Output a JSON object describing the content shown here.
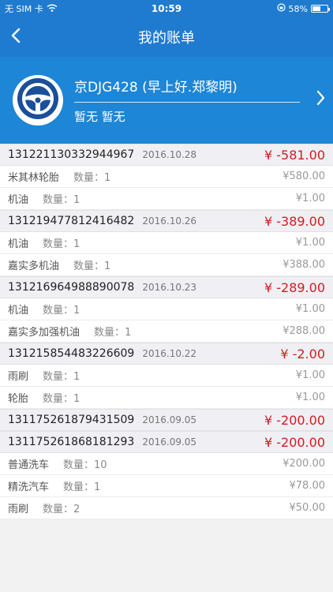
{
  "status": {
    "carrier": "无 SIM 卡",
    "time": "10:59",
    "battery": "58%",
    "battery_level": 0.58
  },
  "nav": {
    "title": "我的账单"
  },
  "profile": {
    "name": "京DJG428 (早上好.郑黎明)",
    "sub": "暂无 暂无"
  },
  "orders": [
    {
      "id": "131221130332944967",
      "date": "2016.10.28",
      "amount": "¥ -581.00",
      "items": [
        {
          "name": "米其林轮胎",
          "qty": "数量：1",
          "price": "¥580.00"
        },
        {
          "name": "机油",
          "qty": "数量：1",
          "price": "¥1.00"
        }
      ]
    },
    {
      "id": "131219477812416482",
      "date": "2016.10.26",
      "amount": "¥ -389.00",
      "items": [
        {
          "name": "机油",
          "qty": "数量：1",
          "price": "¥1.00"
        },
        {
          "name": "嘉实多机油",
          "qty": "数量：1",
          "price": "¥388.00"
        }
      ]
    },
    {
      "id": "131216964988890078",
      "date": "2016.10.23",
      "amount": "¥ -289.00",
      "items": [
        {
          "name": "机油",
          "qty": "数量：1",
          "price": "¥1.00"
        },
        {
          "name": "嘉实多加强机油",
          "qty": "数量：1",
          "price": "¥288.00"
        }
      ]
    },
    {
      "id": "131215854483226609",
      "date": "2016.10.22",
      "amount": "¥ -2.00",
      "items": [
        {
          "name": "雨刷",
          "qty": "数量：1",
          "price": "¥1.00"
        },
        {
          "name": "轮胎",
          "qty": "数量：1",
          "price": "¥1.00"
        }
      ]
    },
    {
      "id": "131175261879431509",
      "date": "2016.09.05",
      "amount": "¥ -200.00",
      "items": []
    },
    {
      "id": "131175261868181293",
      "date": "2016.09.05",
      "amount": "¥ -200.00",
      "items": [
        {
          "name": "普通洗车",
          "qty": "数量：10",
          "price": "¥200.00"
        },
        {
          "name": "精洗汽车",
          "qty": "数量：1",
          "price": "¥78.00"
        },
        {
          "name": "雨刷",
          "qty": "数量：2",
          "price": "¥50.00"
        }
      ]
    }
  ]
}
